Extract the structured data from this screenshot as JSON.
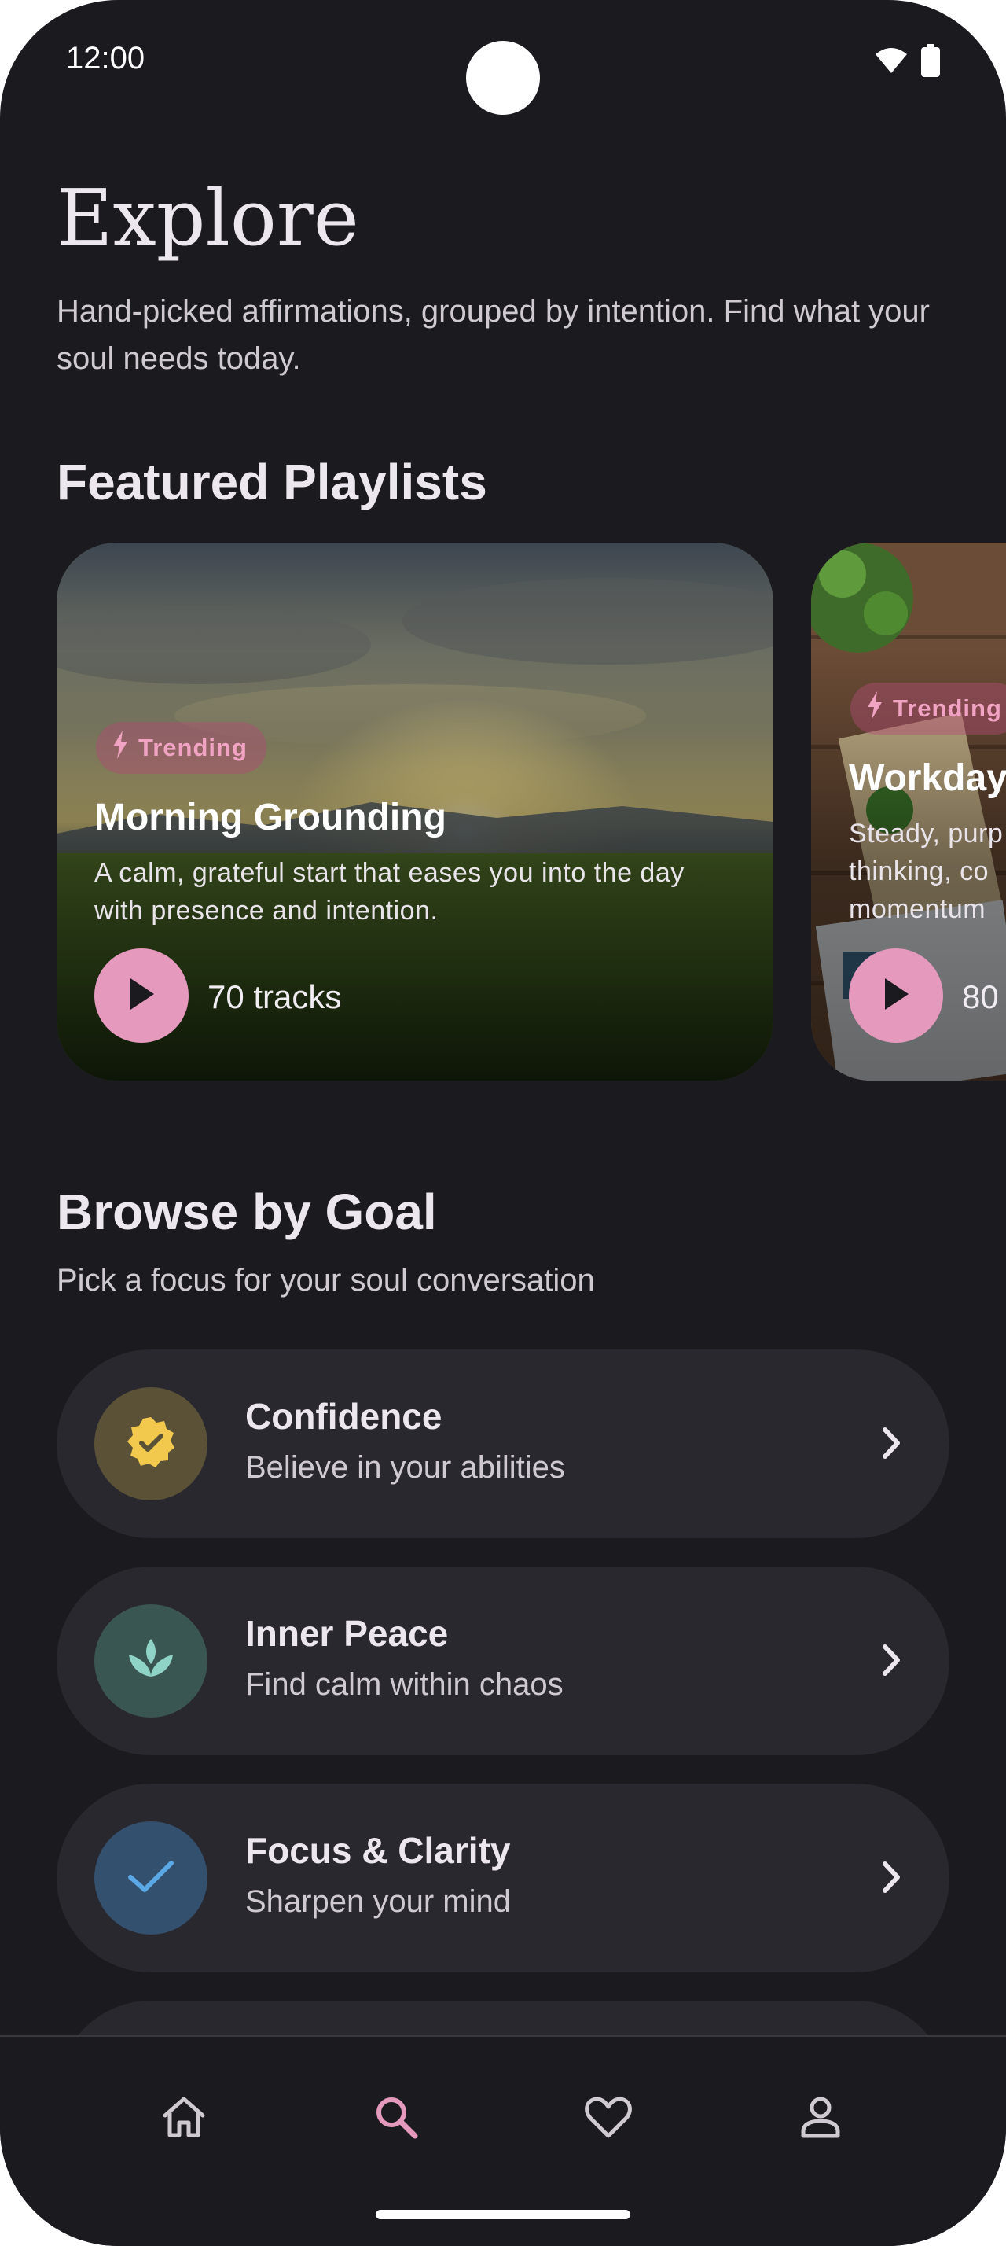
{
  "status": {
    "time": "12:00"
  },
  "header": {
    "title": "Explore",
    "subtitle": "Hand-picked affirmations, grouped by intention. Find what your soul needs today."
  },
  "featured": {
    "section_title": "Featured Playlists",
    "cards": [
      {
        "chip": "Trending",
        "title": "Morning Grounding",
        "description": "A calm, grateful start that eases you into the day with presence and intention.",
        "tracks": "70 tracks"
      },
      {
        "chip": "Trending",
        "title": "Workday",
        "description": "Steady, purp thinking, co momentum",
        "tracks": "80"
      }
    ]
  },
  "browse": {
    "section_title": "Browse by Goal",
    "section_subtitle": "Pick a focus for your soul conversation",
    "goals": [
      {
        "title": "Confidence",
        "subtitle": "Believe in your abilities",
        "icon": "verified-badge-icon",
        "color": "#f2c94c"
      },
      {
        "title": "Inner Peace",
        "subtitle": "Find calm within chaos",
        "icon": "lotus-icon",
        "color": "#8fd3c6"
      },
      {
        "title": "Focus & Clarity",
        "subtitle": "Sharpen your mind",
        "icon": "check-icon",
        "color": "#5aa9e6"
      }
    ]
  },
  "nav": {
    "items": [
      "home-icon",
      "search-icon",
      "heart-icon",
      "person-icon"
    ],
    "active": "search-icon",
    "active_color": "#e599bd"
  },
  "colors": {
    "background": "#1b1a1f",
    "surface": "#29282e",
    "accent": "#e599bd"
  }
}
